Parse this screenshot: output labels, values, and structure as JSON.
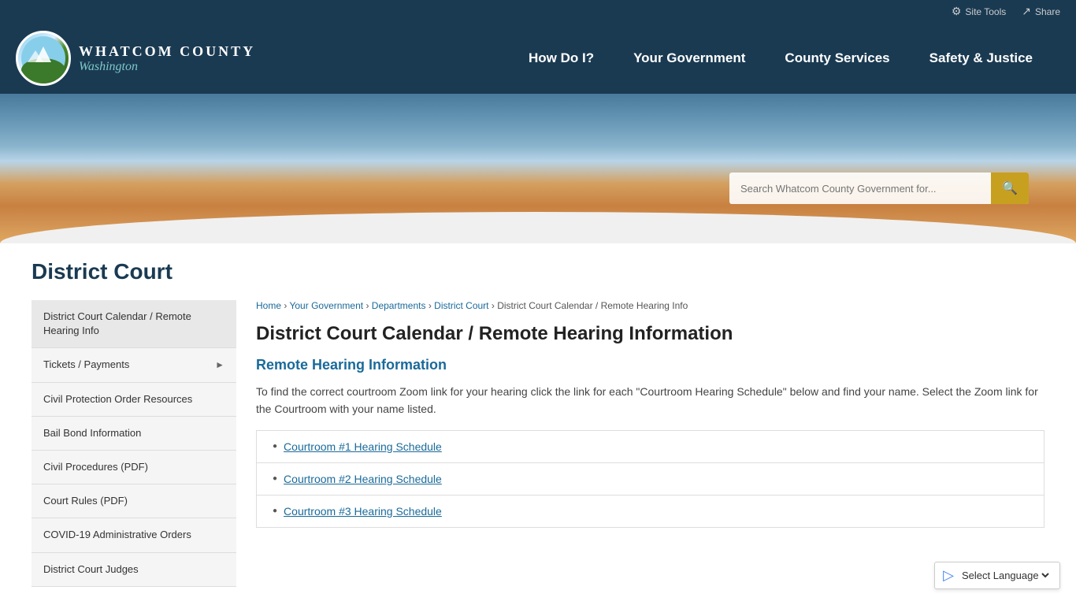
{
  "header": {
    "site_tools_label": "Site Tools",
    "share_label": "Share",
    "logo_line1": "WHATCOM COUNTY",
    "logo_line2": "Washington",
    "search_placeholder": "Search Whatcom County Government for...",
    "nav": [
      {
        "id": "how-do-i",
        "label": "How Do I?"
      },
      {
        "id": "your-government",
        "label": "Your Government"
      },
      {
        "id": "county-services",
        "label": "County Services"
      },
      {
        "id": "safety-justice",
        "label": "Safety & Justice"
      }
    ]
  },
  "page": {
    "title": "District Court",
    "breadcrumbs": [
      {
        "label": "Home",
        "href": "#"
      },
      {
        "label": "Your Government",
        "href": "#"
      },
      {
        "label": "Departments",
        "href": "#"
      },
      {
        "label": "District Court",
        "href": "#"
      },
      {
        "label": "District Court Calendar / Remote Hearing Info",
        "href": "#"
      }
    ],
    "content_title": "District Court Calendar / Remote Hearing Information",
    "section_title": "Remote Hearing Information",
    "content_text": "To find the correct courtroom Zoom link for your hearing click the link for each \"Courtroom Hearing Schedule\" below and find your name.  Select the Zoom link for the Courtroom with your name listed."
  },
  "sidebar": {
    "items": [
      {
        "label": "District Court Calendar / Remote Hearing Info",
        "has_arrow": false
      },
      {
        "label": "Tickets / Payments",
        "has_arrow": true
      },
      {
        "label": "Civil Protection Order Resources",
        "has_arrow": false
      },
      {
        "label": "Bail Bond Information",
        "has_arrow": false
      },
      {
        "label": "Civil Procedures (PDF)",
        "has_arrow": false
      },
      {
        "label": "Court Rules (PDF)",
        "has_arrow": false
      },
      {
        "label": "COVID-19 Administrative Orders",
        "has_arrow": false
      },
      {
        "label": "District Court Judges",
        "has_arrow": false
      }
    ]
  },
  "hearing_schedules": [
    {
      "label": "Courtroom #1 Hearing Schedule"
    },
    {
      "label": "Courtroom #2 Hearing Schedule"
    },
    {
      "label": "Courtroom #3 Hearing Schedule"
    }
  ],
  "language": {
    "label": "Select Language"
  }
}
